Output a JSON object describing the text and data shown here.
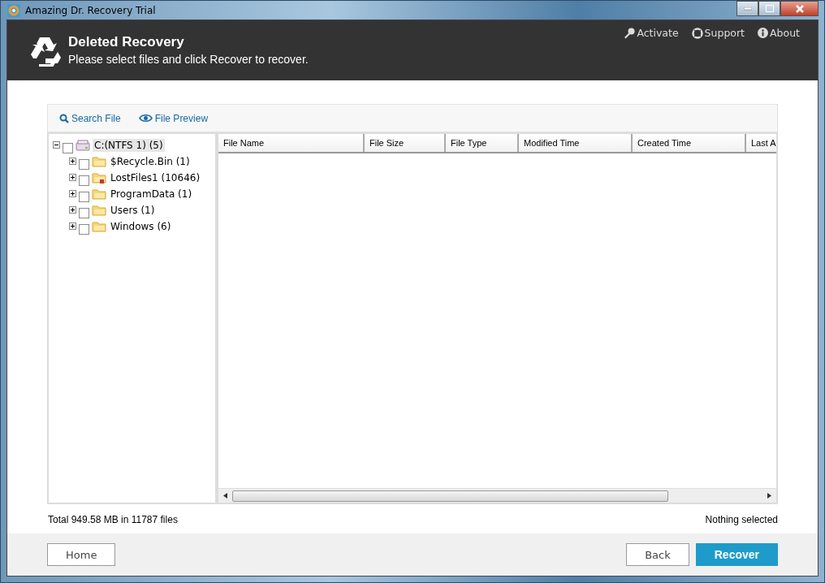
{
  "window": {
    "title": "Amazing Dr. Recovery Trial"
  },
  "header": {
    "title": "Deleted Recovery",
    "subtitle": "Please select files and click Recover to recover.",
    "links": [
      {
        "kind": "key",
        "label": "Activate"
      },
      {
        "kind": "lifebuoy",
        "label": "Support"
      },
      {
        "kind": "info",
        "label": "About"
      }
    ]
  },
  "toolbar": [
    {
      "kind": "search",
      "label": "Search File"
    },
    {
      "kind": "eye",
      "label": "File Preview"
    }
  ],
  "tree": [
    {
      "label": "C:(NTFS 1) (5)",
      "kind": "drive",
      "expanded": true,
      "checked": false,
      "selected": true,
      "children": [
        {
          "label": "$Recycle.Bin (1)",
          "kind": "folder",
          "expanded": false,
          "checked": false,
          "selected": false
        },
        {
          "label": "LostFiles1 (10646)",
          "kind": "lost-folder",
          "expanded": false,
          "checked": false,
          "selected": false
        },
        {
          "label": "ProgramData (1)",
          "kind": "folder",
          "expanded": false,
          "checked": false,
          "selected": false
        },
        {
          "label": "Users (1)",
          "kind": "folder",
          "expanded": false,
          "checked": false,
          "selected": false
        },
        {
          "label": "Windows (6)",
          "kind": "folder",
          "expanded": false,
          "checked": false,
          "selected": false
        }
      ]
    }
  ],
  "table": {
    "columns": [
      "File Name",
      "File Size",
      "File Type",
      "Modified Time",
      "Created Time",
      "Last A"
    ]
  },
  "status": {
    "total": "Total 949.58 MB in 11787 files",
    "selection": "Nothing selected"
  },
  "buttons": [
    {
      "kind": "plain",
      "label": "Home"
    },
    {
      "kind": "plain",
      "label": "Back"
    },
    {
      "kind": "primary",
      "label": "Recover"
    }
  ]
}
